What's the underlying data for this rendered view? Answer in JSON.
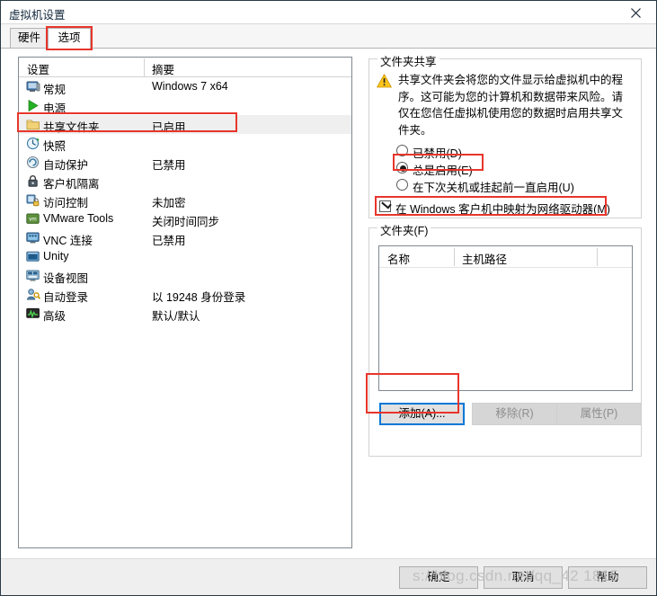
{
  "window": {
    "title": "虚拟机设置",
    "close_icon": "close-icon"
  },
  "tabs": [
    {
      "label": "硬件",
      "name": "tab-hardware",
      "selected": false
    },
    {
      "label": "选项",
      "name": "tab-options",
      "selected": true
    }
  ],
  "settings_list": {
    "headers": [
      "设置",
      "摘要"
    ],
    "rows": [
      {
        "icon": "monitor-icon",
        "label": "常规",
        "summary": "Windows 7 x64",
        "selected": false
      },
      {
        "icon": "power-play-icon",
        "label": "电源",
        "summary": "",
        "selected": false
      },
      {
        "icon": "folder-icon",
        "label": "共享文件夹",
        "summary": "已启用",
        "selected": true
      },
      {
        "icon": "snapshot-icon",
        "label": "快照",
        "summary": "",
        "selected": false
      },
      {
        "icon": "autoprotect-icon",
        "label": "自动保护",
        "summary": "已禁用",
        "selected": false
      },
      {
        "icon": "lock-icon",
        "label": "客户机隔离",
        "summary": "",
        "selected": false
      },
      {
        "icon": "access-control-icon",
        "label": "访问控制",
        "summary": "未加密",
        "selected": false
      },
      {
        "icon": "vmware-tools-icon",
        "label": "VMware Tools",
        "summary": "关闭时间同步",
        "selected": false
      },
      {
        "icon": "vnc-icon",
        "label": "VNC 连接",
        "summary": "已禁用",
        "selected": false
      },
      {
        "icon": "unity-icon",
        "label": "Unity",
        "summary": "",
        "selected": false
      },
      {
        "icon": "device-view-icon",
        "label": "设备视图",
        "summary": "",
        "selected": false
      },
      {
        "icon": "auto-login-icon",
        "label": "自动登录",
        "summary": "以 19248 身份登录",
        "selected": false
      },
      {
        "icon": "advanced-icon",
        "label": "高级",
        "summary": "默认/默认",
        "selected": false
      }
    ]
  },
  "folder_sharing": {
    "group_title": "文件夹共享",
    "warning_icon": "warning-icon",
    "warning_text": "共享文件夹会将您的文件显示给虚拟机中的程序。这可能为您的计算机和数据带来风险。请仅在您信任虚拟机使用您的数据时启用共享文件夹。",
    "radios": [
      {
        "label": "已禁用(D)",
        "checked": false,
        "name": "radio-disabled"
      },
      {
        "label": "总是启用(E)",
        "checked": true,
        "name": "radio-always"
      },
      {
        "label": "在下次关机或挂起前一直启用(U)",
        "checked": false,
        "name": "radio-until"
      }
    ],
    "checkbox": {
      "label": "在 Windows 客户机中映射为网络驱动器(M)",
      "checked": true
    }
  },
  "folders": {
    "group_title": "文件夹(F)",
    "headers": [
      "名称",
      "主机路径"
    ],
    "rows": [],
    "buttons": [
      {
        "label": "添加(A)...",
        "name": "add-folder-button",
        "enabled": true,
        "focused": true
      },
      {
        "label": "移除(R)",
        "name": "remove-folder-button",
        "enabled": false,
        "focused": false
      },
      {
        "label": "属性(P)",
        "name": "folder-properties-button",
        "enabled": false,
        "focused": false
      }
    ]
  },
  "footer": {
    "ok": "确定",
    "cancel": "取消",
    "help": "帮助"
  },
  "watermark": "s://blog.csdn.net/qq_42  1815",
  "colors": {
    "accent": "#0078d7",
    "annotation": "#e8352b",
    "selection": "#efefef",
    "warning": "#ffc61a"
  }
}
